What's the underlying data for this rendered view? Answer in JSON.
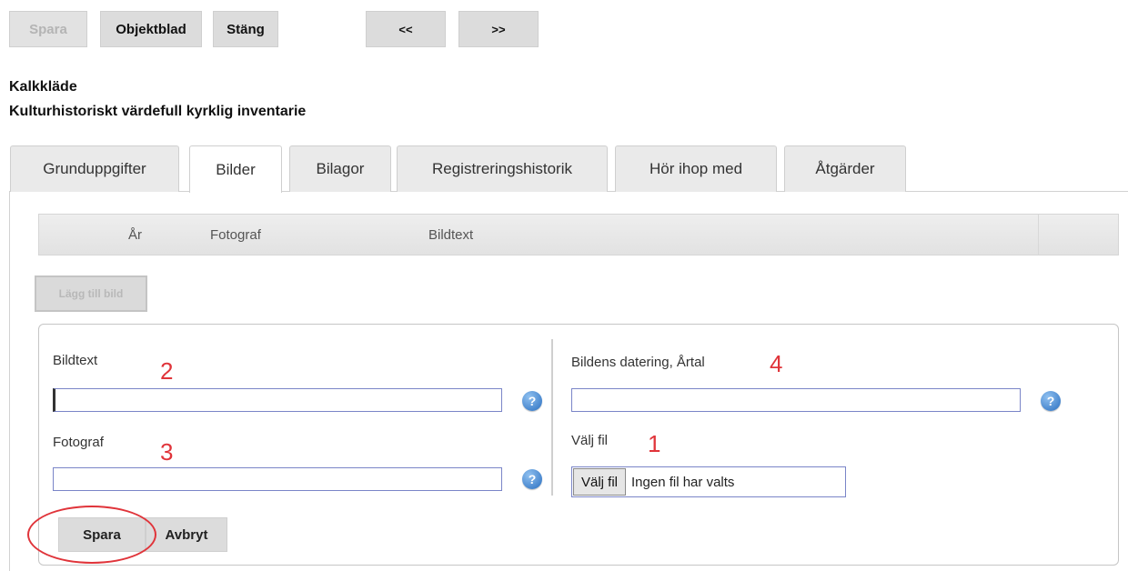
{
  "toolbar": {
    "save_label": "Spara",
    "object_sheet_label": "Objektblad",
    "close_label": "Stäng",
    "prev_label": "<<",
    "next_label": ">>"
  },
  "header": {
    "title": "Kalkkläde",
    "subtitle": "Kulturhistoriskt värdefull kyrklig inventarie"
  },
  "tabs": [
    {
      "label": "Grunduppgifter",
      "active": false
    },
    {
      "label": "Bilder",
      "active": true
    },
    {
      "label": "Bilagor",
      "active": false
    },
    {
      "label": "Registreringshistorik",
      "active": false
    },
    {
      "label": "Hör ihop med",
      "active": false
    },
    {
      "label": "Åtgärder",
      "active": false
    }
  ],
  "grid": {
    "columns": [
      "År",
      "Fotograf",
      "Bildtext"
    ]
  },
  "add_image_label": "Lägg till bild",
  "form": {
    "caption": {
      "label": "Bildtext",
      "value": "",
      "annotation": "2"
    },
    "photographer": {
      "label": "Fotograf",
      "value": "",
      "annotation": "3"
    },
    "dating": {
      "label": "Bildens datering, Årtal",
      "value": "",
      "annotation": "4"
    },
    "file": {
      "label": "Välj fil",
      "button_label": "Välj fil",
      "status": "Ingen fil har valts",
      "annotation": "1"
    },
    "help_glyph": "?",
    "save_label": "Spara",
    "cancel_label": "Avbryt"
  },
  "colors": {
    "annotation_red": "#e0343a",
    "input_border": "#7a85c8",
    "help_blue": "#2a6fc0"
  }
}
